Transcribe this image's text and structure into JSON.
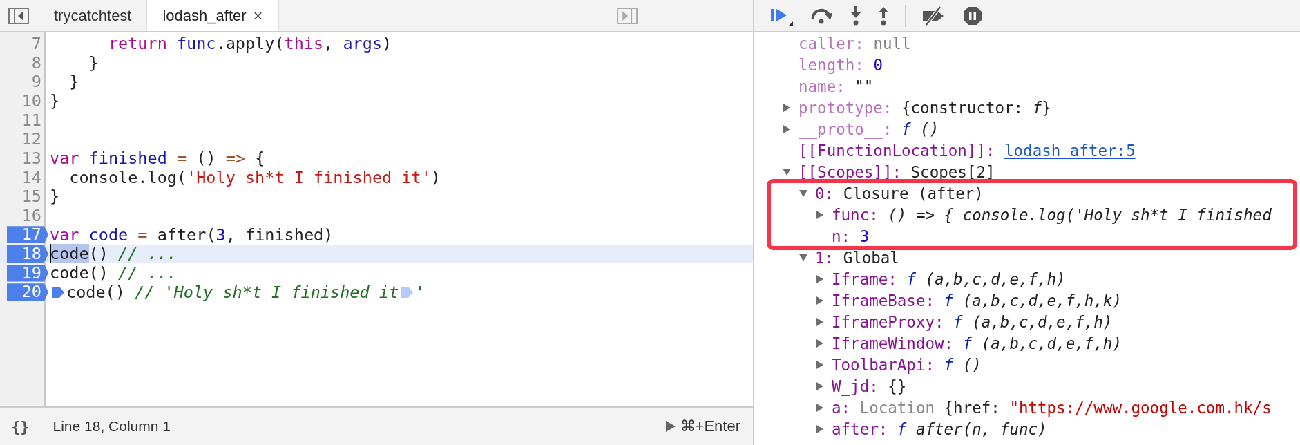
{
  "editor": {
    "tabs": [
      {
        "label": "trycatchtest",
        "selected": false,
        "closable": false
      },
      {
        "label": "lodash_after",
        "selected": true,
        "closable": true,
        "close": "×"
      }
    ],
    "lines": [
      {
        "n": "7",
        "breakpoint": false,
        "current": false,
        "tokens": [
          {
            "kind": "kw",
            "text": "      return"
          },
          {
            "kind": "def",
            "text": " func"
          },
          {
            "kind": "plain",
            "text": ".apply("
          },
          {
            "kind": "kw",
            "text": "this"
          },
          {
            "kind": "plain",
            "text": ", "
          },
          {
            "kind": "def",
            "text": "args"
          },
          {
            "kind": "plain",
            "text": ")"
          }
        ]
      },
      {
        "n": "8",
        "breakpoint": false,
        "current": false,
        "tokens": [
          {
            "kind": "plain",
            "text": "    }"
          }
        ]
      },
      {
        "n": "9",
        "breakpoint": false,
        "current": false,
        "tokens": [
          {
            "kind": "plain",
            "text": "  }"
          }
        ]
      },
      {
        "n": "10",
        "breakpoint": false,
        "current": false,
        "tokens": [
          {
            "kind": "plain",
            "text": "}"
          }
        ]
      },
      {
        "n": "11",
        "breakpoint": false,
        "current": false
      },
      {
        "n": "12",
        "breakpoint": false,
        "current": false
      },
      {
        "n": "13",
        "breakpoint": false,
        "current": false,
        "tokens": [
          {
            "kind": "kw",
            "text": "var"
          },
          {
            "kind": "def",
            "text": " finished"
          },
          {
            "kind": "op",
            "text": " ="
          },
          {
            "kind": "plain",
            "text": " () "
          },
          {
            "kind": "op",
            "text": "=>"
          },
          {
            "kind": "plain",
            "text": " {"
          }
        ]
      },
      {
        "n": "14",
        "breakpoint": false,
        "current": false,
        "tokens": [
          {
            "kind": "plain",
            "text": "  console.log("
          },
          {
            "kind": "str",
            "text": "'Holy sh*t I finished it'"
          },
          {
            "kind": "plain",
            "text": ")"
          }
        ]
      },
      {
        "n": "15",
        "breakpoint": false,
        "current": false,
        "tokens": [
          {
            "kind": "plain",
            "text": "}"
          }
        ]
      },
      {
        "n": "16",
        "breakpoint": false,
        "current": false
      },
      {
        "n": "17",
        "breakpoint": true,
        "current": false,
        "tokens": [
          {
            "kind": "kw",
            "text": "var"
          },
          {
            "kind": "def",
            "text": " code"
          },
          {
            "kind": "op",
            "text": " ="
          },
          {
            "kind": "plain",
            "text": " after("
          },
          {
            "kind": "num",
            "text": "3"
          },
          {
            "kind": "plain",
            "text": ", finished)"
          }
        ]
      },
      {
        "n": "18",
        "breakpoint": true,
        "current": true,
        "tokens": [
          {
            "kind": "sel",
            "text": "code"
          },
          {
            "kind": "plain",
            "text": "() "
          },
          {
            "kind": "cmt",
            "text": "// ..."
          }
        ]
      },
      {
        "n": "19",
        "breakpoint": true,
        "current": false,
        "tokens": [
          {
            "kind": "plain",
            "text": "code() "
          },
          {
            "kind": "cmt",
            "text": "// ..."
          }
        ]
      },
      {
        "n": "20",
        "breakpoint": true,
        "current": false,
        "tokens": [
          {
            "kind": "bp",
            "on": true
          },
          {
            "kind": "plain",
            "text": "code() "
          },
          {
            "kind": "cmt",
            "text": "// 'Holy sh*t I finished it"
          },
          {
            "kind": "bp",
            "on": false
          },
          {
            "kind": "cmt",
            "text": "'"
          }
        ]
      }
    ],
    "status": {
      "format": "{}",
      "position": "Line 18, Column 1",
      "run": "⌘+Enter"
    }
  },
  "scope": {
    "nodes": [
      {
        "key": "caller:",
        "dim": true,
        "value": [
          {
            "kind": "null",
            "text": "null"
          }
        ]
      },
      {
        "key": "length:",
        "dim": true,
        "value": [
          {
            "kind": "num",
            "text": "0"
          }
        ]
      },
      {
        "key": "name:",
        "dim": true,
        "value": [
          {
            "kind": "plain",
            "text": "\"\""
          }
        ]
      },
      {
        "key": "prototype:",
        "dim": true,
        "expanded": false,
        "value": [
          {
            "kind": "plain",
            "text": "{constructor: "
          },
          {
            "kind": "ital",
            "text": "f"
          },
          {
            "kind": "plain",
            "text": "}"
          }
        ]
      },
      {
        "key": "__proto__:",
        "dim": true,
        "expanded": false,
        "value": [
          {
            "kind": "fn",
            "text": "f"
          },
          {
            "kind": "ital",
            "text": " ()"
          }
        ]
      },
      {
        "key": "[[FunctionLocation]]:",
        "dim": false,
        "value": [
          {
            "kind": "link",
            "text": "lodash_after:5"
          }
        ]
      },
      {
        "key": "[[Scopes]]:",
        "dim": false,
        "expanded": true,
        "value": [
          {
            "kind": "plain",
            "text": "Scopes[2]"
          }
        ],
        "children": [
          {
            "key": "0:",
            "dim": false,
            "expanded": true,
            "highlighted": true,
            "value": [
              {
                "kind": "plain",
                "text": "Closure (after)"
              }
            ],
            "children": [
              {
                "key": "func:",
                "dim": false,
                "expanded": false,
                "value": [
                  {
                    "kind": "ital",
                    "text": "() => { console.log('Holy sh*t I finished"
                  }
                ]
              },
              {
                "key": "n:",
                "dim": false,
                "value": [
                  {
                    "kind": "num",
                    "text": "3"
                  }
                ]
              }
            ]
          },
          {
            "key": "1:",
            "dim": false,
            "expanded": true,
            "highlighted": false,
            "value": [
              {
                "kind": "plain",
                "text": "Global"
              }
            ],
            "children": [
              {
                "key": "Iframe:",
                "dim": false,
                "expanded": false,
                "value": [
                  {
                    "kind": "fn",
                    "text": "f"
                  },
                  {
                    "kind": "ital",
                    "text": " (a,b,c,d,e,f,h)"
                  }
                ]
              },
              {
                "key": "IframeBase:",
                "dim": false,
                "expanded": false,
                "value": [
                  {
                    "kind": "fn",
                    "text": "f"
                  },
                  {
                    "kind": "ital",
                    "text": " (a,b,c,d,e,f,h,k)"
                  }
                ]
              },
              {
                "key": "IframeProxy:",
                "dim": false,
                "expanded": false,
                "value": [
                  {
                    "kind": "fn",
                    "text": "f"
                  },
                  {
                    "kind": "ital",
                    "text": " (a,b,c,d,e,f,h)"
                  }
                ]
              },
              {
                "key": "IframeWindow:",
                "dim": false,
                "expanded": false,
                "value": [
                  {
                    "kind": "fn",
                    "text": "f"
                  },
                  {
                    "kind": "ital",
                    "text": " (a,b,c,d,e,f,h)"
                  }
                ]
              },
              {
                "key": "ToolbarApi:",
                "dim": false,
                "expanded": false,
                "value": [
                  {
                    "kind": "fn",
                    "text": "f"
                  },
                  {
                    "kind": "ital",
                    "text": " ()"
                  }
                ]
              },
              {
                "key": "W_jd:",
                "dim": false,
                "expanded": false,
                "value": [
                  {
                    "kind": "plain",
                    "text": "{}"
                  }
                ]
              },
              {
                "key": "a:",
                "dim": false,
                "expanded": false,
                "value": [
                  {
                    "kind": "gray",
                    "text": "Location"
                  },
                  {
                    "kind": "plain",
                    "text": " {href: "
                  },
                  {
                    "kind": "rstr",
                    "text": "\"https://www.google.com.hk/s"
                  }
                ]
              },
              {
                "key": "after:",
                "dim": false,
                "expanded": false,
                "value": [
                  {
                    "kind": "fn",
                    "text": "f"
                  },
                  {
                    "kind": "ital",
                    "text": " after(n, func)"
                  }
                ]
              }
            ]
          }
        ]
      }
    ]
  }
}
